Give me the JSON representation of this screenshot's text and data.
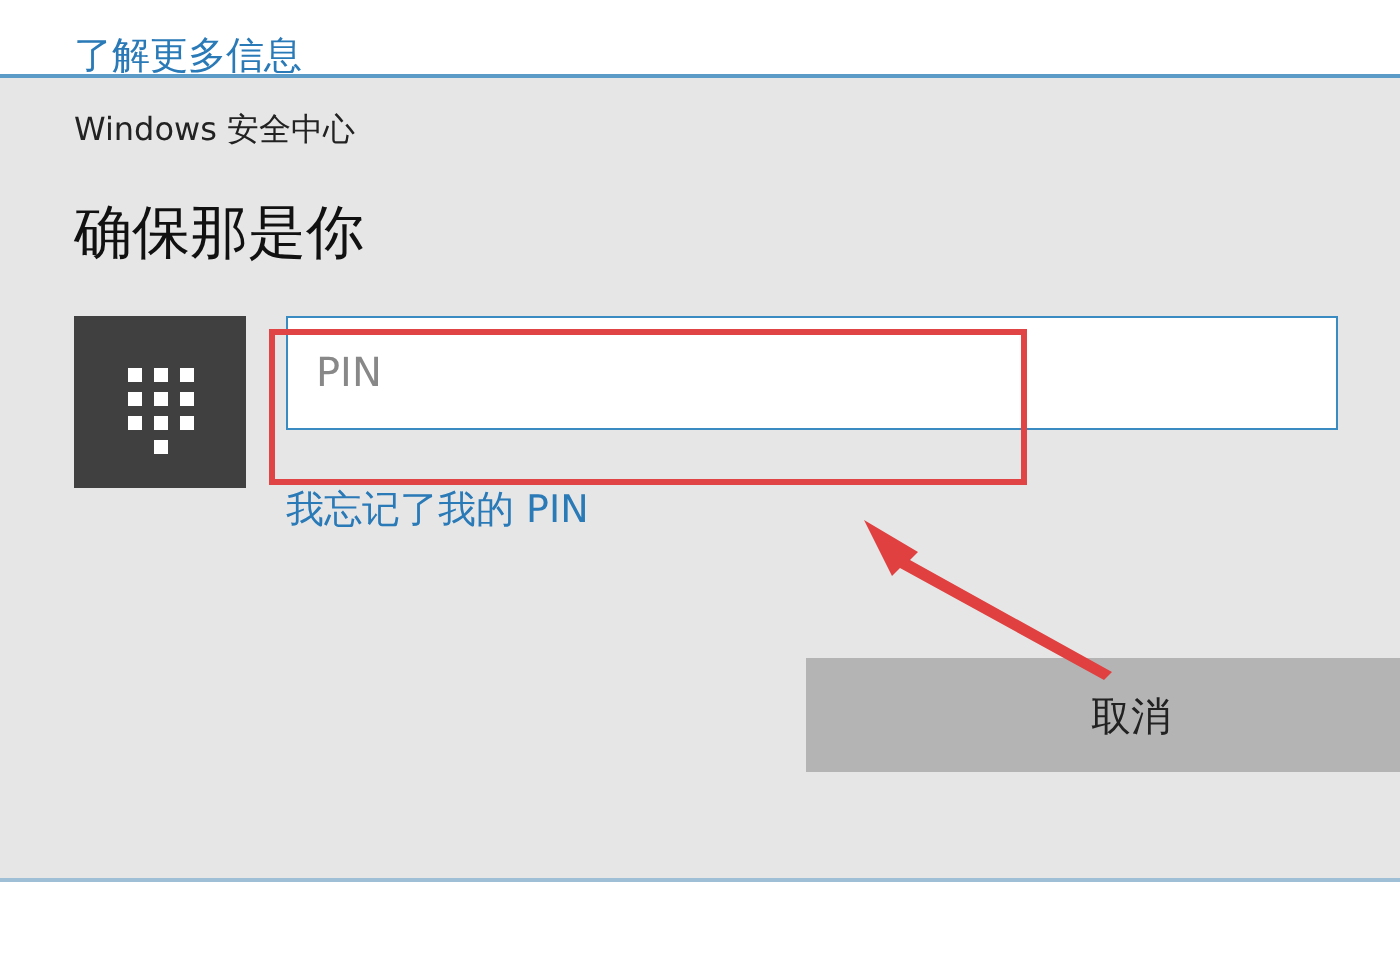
{
  "background_link": "了解更多信息",
  "dialog": {
    "title": "Windows 安全中心",
    "heading": "确保那是你",
    "pin_field": {
      "placeholder": "PIN"
    },
    "forgot_link": "我忘记了我的 PIN",
    "buttons": [
      "取消"
    ]
  },
  "annotations": {
    "highlight_box": true,
    "arrow": true
  }
}
